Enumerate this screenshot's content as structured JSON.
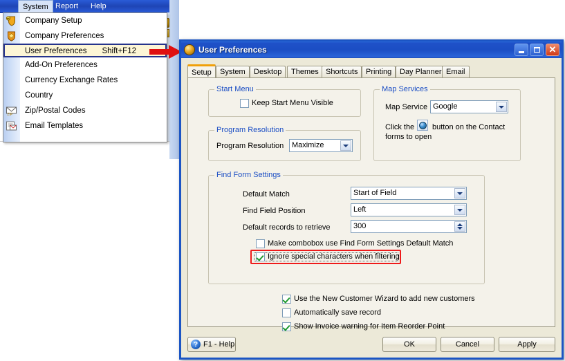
{
  "background_app": {
    "menubar": [
      {
        "label": "System",
        "mnemonic": "m",
        "active": true
      },
      {
        "label": "Report",
        "mnemonic": "R",
        "active": false
      },
      {
        "label": "Help",
        "mnemonic": "H",
        "active": false
      }
    ],
    "open_menu": {
      "name": "System",
      "items": [
        {
          "label": "Company Setup",
          "icon": "shield-key-icon",
          "accel": "",
          "selected": false
        },
        {
          "label": "Company Preferences",
          "icon": "shield-star-icon",
          "accel": "",
          "selected": false
        },
        {
          "label": "User Preferences",
          "icon": "user-prefs-icon",
          "accel": "Shift+F12",
          "selected": true
        },
        {
          "label": "Add-On Preferences",
          "icon": "",
          "accel": "",
          "selected": false
        },
        {
          "label": "Currency Exchange Rates",
          "icon": "",
          "accel": "",
          "selected": false
        },
        {
          "label": "Country",
          "icon": "",
          "accel": "",
          "selected": false
        },
        {
          "label": "Zip/Postal Codes",
          "icon": "envelope-zip-icon",
          "accel": "",
          "selected": false
        },
        {
          "label": "Email Templates",
          "icon": "email-template-icon",
          "accel": "",
          "selected": false
        }
      ]
    }
  },
  "annotation": {
    "arrow": "red-right-arrow",
    "highlight_box_color": "#ee1b1b"
  },
  "dialog": {
    "title": "User Preferences",
    "title_icon": "amber-sphere-icon",
    "window_buttons": {
      "minimize": "minimize-icon",
      "maximize": "maximize-icon",
      "close": "close-icon",
      "close_label": "✕"
    },
    "tabs": [
      {
        "label": "Setup",
        "active": true
      },
      {
        "label": "System",
        "active": false
      },
      {
        "label": "Desktop",
        "active": false
      },
      {
        "label": "Themes",
        "active": false
      },
      {
        "label": "Shortcuts",
        "active": false
      },
      {
        "label": "Printing",
        "active": false
      },
      {
        "label": "Day Planner",
        "active": false
      },
      {
        "label": "Email",
        "active": false
      }
    ],
    "groups": {
      "start_menu": {
        "title": "Start Menu",
        "checkbox": {
          "label": "Keep Start Menu Visible",
          "checked": false
        }
      },
      "program_resolution": {
        "title": "Program Resolution",
        "field_label": "Program Resolution",
        "combo_value": "Maximize"
      },
      "map_services": {
        "title": "Map Services",
        "field_label": "Map Service",
        "combo_value": "Google",
        "hint_before": "Click the",
        "hint_after": "button on the Contact",
        "hint_line2": "forms to open",
        "hint_icon": "globe-icon"
      },
      "find_form_settings": {
        "title": "Find Form Settings",
        "rows": [
          {
            "label": "Default Match",
            "value": "Start of Field",
            "control": "combo"
          },
          {
            "label": "Find Field Position",
            "value": "Left",
            "control": "combo"
          },
          {
            "label": "Default records to retrieve",
            "value": "300",
            "control": "spinner"
          }
        ],
        "checkboxes": [
          {
            "label": "Make combobox use Find Form Settings Default Match",
            "checked": false,
            "highlighted": false,
            "focused": false
          },
          {
            "label": "Ignore special characters when filtering",
            "checked": true,
            "highlighted": true,
            "focused": true
          }
        ]
      }
    },
    "bottom_checkboxes": [
      {
        "label": "Use the New Customer Wizard to add new customers",
        "checked": true
      },
      {
        "label": "Automatically save record",
        "checked": false
      },
      {
        "label": "Show Invoice warning for Item Reorder Point",
        "checked": true
      }
    ],
    "buttons": {
      "help": {
        "label": "F1 - Help",
        "icon": "help-question-icon",
        "icon_glyph": "?"
      },
      "ok": {
        "label": "OK"
      },
      "cancel": {
        "label": "Cancel"
      },
      "apply": {
        "label": "Apply"
      }
    }
  }
}
